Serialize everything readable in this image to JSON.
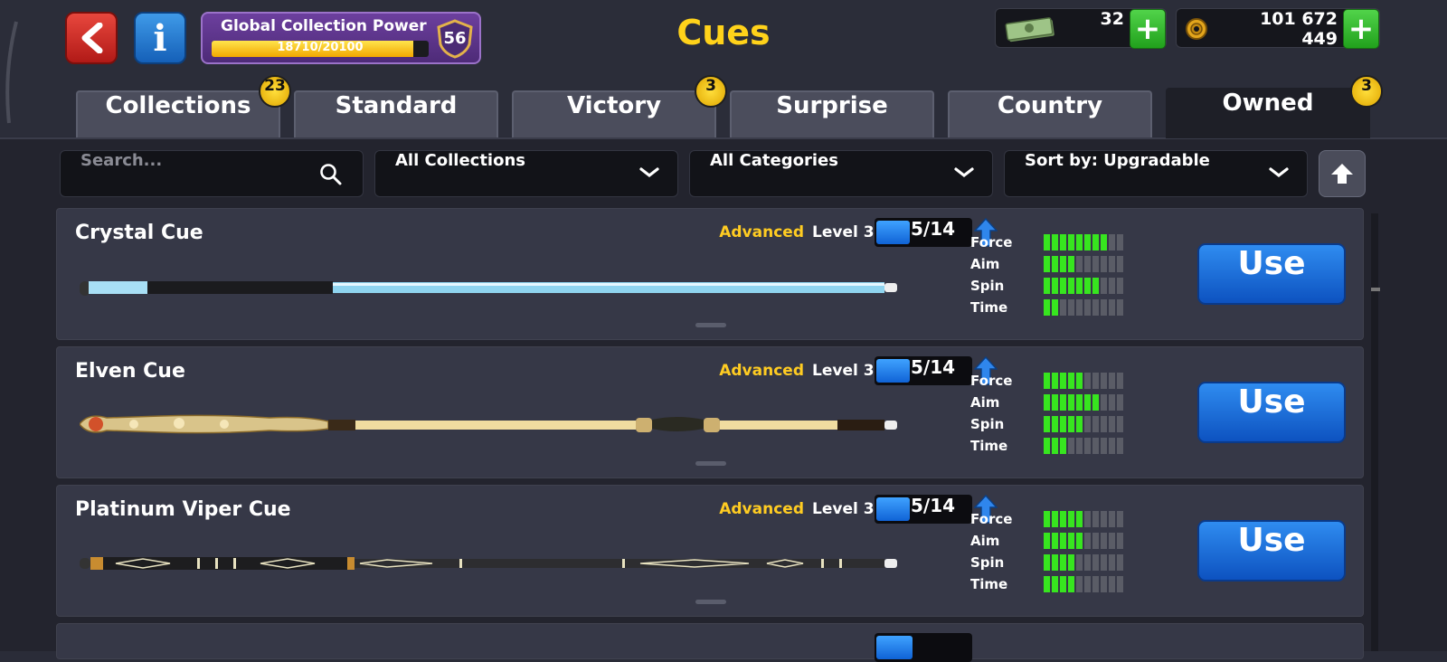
{
  "header": {
    "title": "Cues",
    "power": {
      "label": "Global Collection Power",
      "text": "18710/20100",
      "current": 18710,
      "max": 20100,
      "level": "56"
    },
    "cash": {
      "value": "32"
    },
    "coins": {
      "value": "101 672 449"
    }
  },
  "tabs": [
    {
      "label": "Collections",
      "badge": "23",
      "active": false
    },
    {
      "label": "Standard",
      "badge": "",
      "active": false
    },
    {
      "label": "Victory",
      "badge": "3",
      "active": false
    },
    {
      "label": "Surprise",
      "badge": "",
      "active": false
    },
    {
      "label": "Country",
      "badge": "",
      "active": false
    },
    {
      "label": "Owned",
      "badge": "3",
      "active": true
    }
  ],
  "filters": {
    "search_placeholder": "Search...",
    "collections": "All Collections",
    "categories": "All Categories",
    "sort": "Sort by: Upgradable"
  },
  "stat_labels": [
    "Force",
    "Aim",
    "Spin",
    "Time"
  ],
  "cues": [
    {
      "name": "Crystal Cue",
      "rarity": "Advanced",
      "level": "Level 3",
      "progress": "5/14",
      "progress_fraction": 0.36,
      "stats": {
        "force": 8,
        "aim": 4,
        "spin": 7,
        "time": 2
      },
      "button": "Use"
    },
    {
      "name": "Elven Cue",
      "rarity": "Advanced",
      "level": "Level 3",
      "progress": "5/14",
      "progress_fraction": 0.36,
      "stats": {
        "force": 5,
        "aim": 7,
        "spin": 5,
        "time": 3
      },
      "button": "Use"
    },
    {
      "name": "Platinum Viper Cue",
      "rarity": "Advanced",
      "level": "Level 3",
      "progress": "5/14",
      "progress_fraction": 0.36,
      "stats": {
        "force": 5,
        "aim": 5,
        "spin": 4,
        "time": 4
      },
      "button": "Use"
    }
  ],
  "stat_max": 10,
  "colors": {
    "title": "#ffd21a",
    "rarity": "#ffcc22",
    "stat_on": "#37e51f",
    "use_button": "#1a6ee0",
    "power_panel": "#5a3488"
  }
}
